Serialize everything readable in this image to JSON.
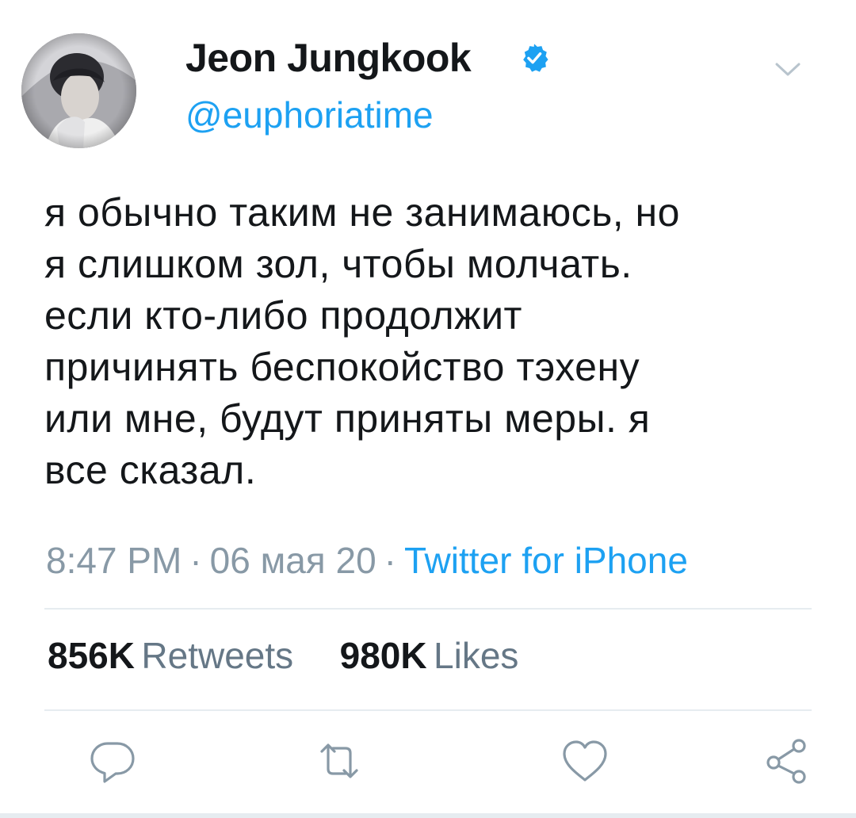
{
  "tweet": {
    "author": {
      "display_name": "Jeon Jungkook",
      "handle": "@euphoriatime",
      "verified": true
    },
    "text_lines": [
      "я обычно таким не занимаюсь, но",
      "я слишком зол, чтобы молчать.",
      "если кто-либо продолжит",
      "причинять беспокойство тэхену",
      "или мне, будут приняты меры. я",
      "все сказал."
    ],
    "time": "8:47 PM",
    "date": "06 мая 20",
    "separator": "·",
    "source": "Twitter for iPhone",
    "stats": {
      "retweets_count": "856K",
      "retweets_label": "Retweets",
      "likes_count": "980K",
      "likes_label": "Likes"
    }
  },
  "icons": {
    "verified": "verified-badge-icon",
    "caret": "chevron-down-icon",
    "reply": "reply-icon",
    "retweet": "retweet-icon",
    "like": "heart-icon",
    "share": "share-icon"
  },
  "colors": {
    "text": "#14171a",
    "accent": "#1da1f2",
    "muted": "#8899a6",
    "icon": "#8899a6",
    "divider": "#e6ecf0"
  }
}
